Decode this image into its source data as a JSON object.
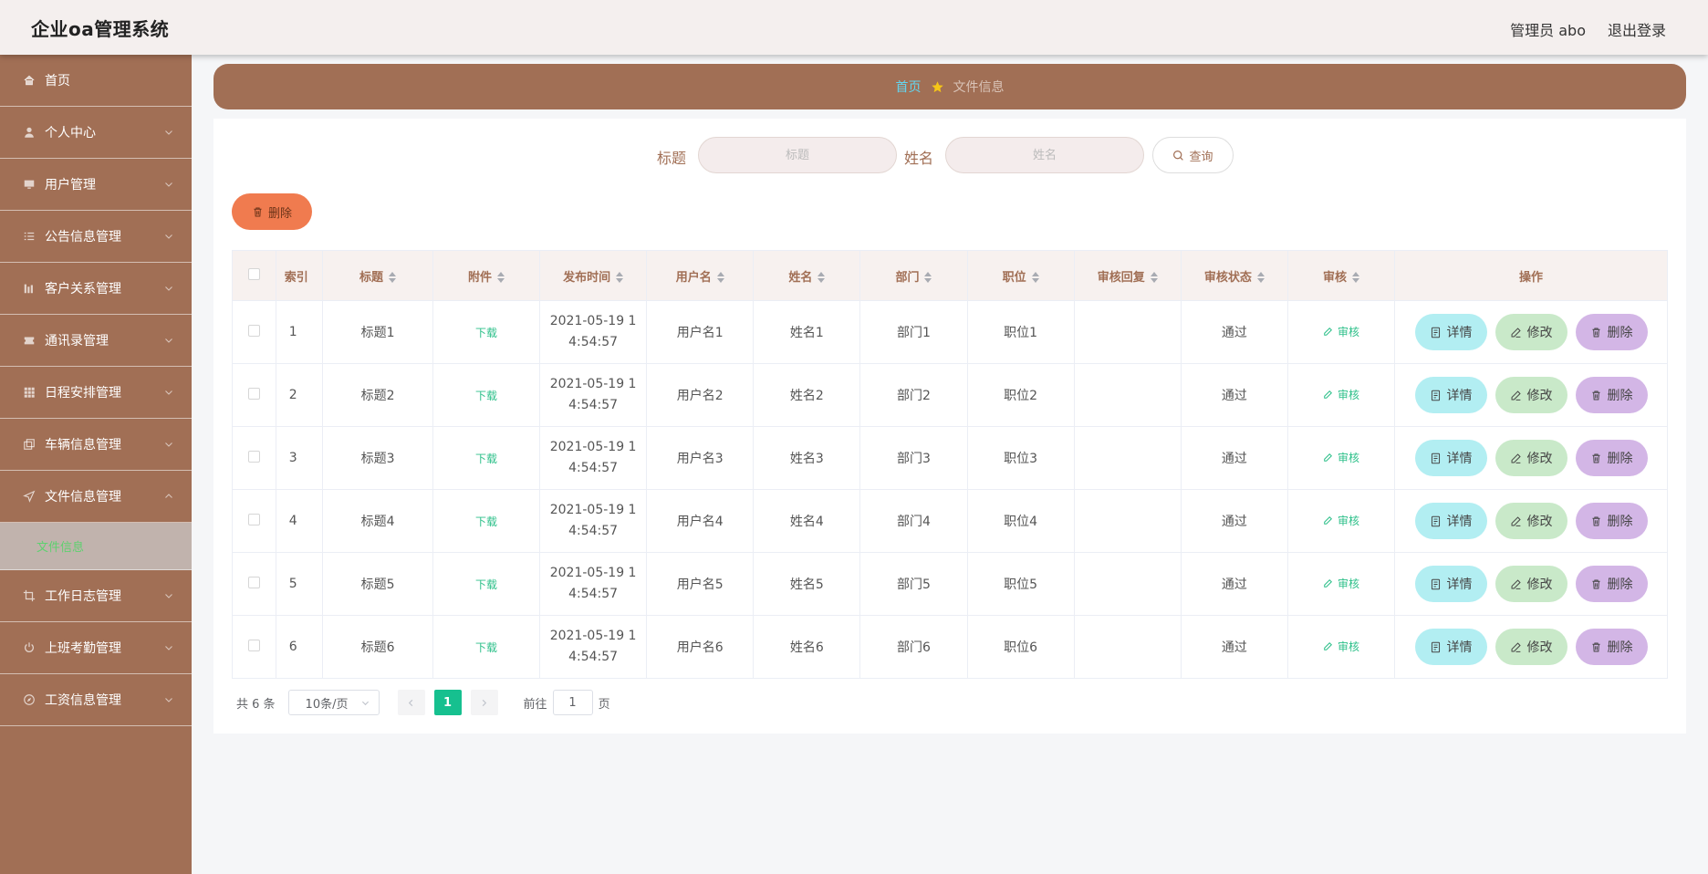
{
  "app": {
    "title": "企业oa管理系统",
    "admin_label": "管理员 abo",
    "logout_label": "退出登录"
  },
  "sidebar": {
    "items": [
      {
        "label": "首页",
        "icon": "home-icon"
      },
      {
        "label": "个人中心",
        "icon": "user-icon"
      },
      {
        "label": "用户管理",
        "icon": "monitor-icon"
      },
      {
        "label": "公告信息管理",
        "icon": "list-icon"
      },
      {
        "label": "客户关系管理",
        "icon": "bar-chart-icon"
      },
      {
        "label": "通讯录管理",
        "icon": "ticket-icon"
      },
      {
        "label": "日程安排管理",
        "icon": "grid-icon"
      },
      {
        "label": "车辆信息管理",
        "icon": "copy-icon"
      },
      {
        "label": "文件信息管理",
        "icon": "send-icon"
      },
      {
        "label": "工作日志管理",
        "icon": "crop-icon"
      },
      {
        "label": "上班考勤管理",
        "icon": "power-icon"
      },
      {
        "label": "工资信息管理",
        "icon": "compass-icon"
      }
    ],
    "sub_item": "文件信息"
  },
  "breadcrumb": {
    "home": "首页",
    "current": "文件信息"
  },
  "search": {
    "title_label": "标题",
    "title_placeholder": "标题",
    "name_label": "姓名",
    "name_placeholder": "姓名",
    "query_label": "查询"
  },
  "toolbar": {
    "delete_label": "删除"
  },
  "table": {
    "headers": [
      "索引",
      "标题",
      "附件",
      "发布时间",
      "用户名",
      "姓名",
      "部门",
      "职位",
      "审核回复",
      "审核状态",
      "审核",
      "操作"
    ],
    "rows": [
      {
        "index": "1",
        "title": "标题1",
        "attachment": "下载",
        "time_line1": "2021-05-19 1",
        "time_line2": "4:54:57",
        "username": "用户名1",
        "name": "姓名1",
        "dept": "部门1",
        "position": "职位1",
        "reply": "",
        "status": "通过",
        "audit": "审核"
      },
      {
        "index": "2",
        "title": "标题2",
        "attachment": "下载",
        "time_line1": "2021-05-19 1",
        "time_line2": "4:54:57",
        "username": "用户名2",
        "name": "姓名2",
        "dept": "部门2",
        "position": "职位2",
        "reply": "",
        "status": "通过",
        "audit": "审核"
      },
      {
        "index": "3",
        "title": "标题3",
        "attachment": "下载",
        "time_line1": "2021-05-19 1",
        "time_line2": "4:54:57",
        "username": "用户名3",
        "name": "姓名3",
        "dept": "部门3",
        "position": "职位3",
        "reply": "",
        "status": "通过",
        "audit": "审核"
      },
      {
        "index": "4",
        "title": "标题4",
        "attachment": "下载",
        "time_line1": "2021-05-19 1",
        "time_line2": "4:54:57",
        "username": "用户名4",
        "name": "姓名4",
        "dept": "部门4",
        "position": "职位4",
        "reply": "",
        "status": "通过",
        "audit": "审核"
      },
      {
        "index": "5",
        "title": "标题5",
        "attachment": "下载",
        "time_line1": "2021-05-19 1",
        "time_line2": "4:54:57",
        "username": "用户名5",
        "name": "姓名5",
        "dept": "部门5",
        "position": "职位5",
        "reply": "",
        "status": "通过",
        "audit": "审核"
      },
      {
        "index": "6",
        "title": "标题6",
        "attachment": "下载",
        "time_line1": "2021-05-19 1",
        "time_line2": "4:54:57",
        "username": "用户名6",
        "name": "姓名6",
        "dept": "部门6",
        "position": "职位6",
        "reply": "",
        "status": "通过",
        "audit": "审核"
      }
    ],
    "row_actions": {
      "detail": "详情",
      "edit": "修改",
      "delete": "删除"
    }
  },
  "pagination": {
    "total": "共 6 条",
    "page_size": "10条/页",
    "current_page": "1",
    "goto_label": "前往",
    "goto_value": "1",
    "page_suffix": "页"
  },
  "colors": {
    "brand_brown": "#a16f55",
    "accent_green": "#16c08f",
    "delete_orange": "#f07b4f",
    "breadcrumb_home": "#63d6f0"
  }
}
